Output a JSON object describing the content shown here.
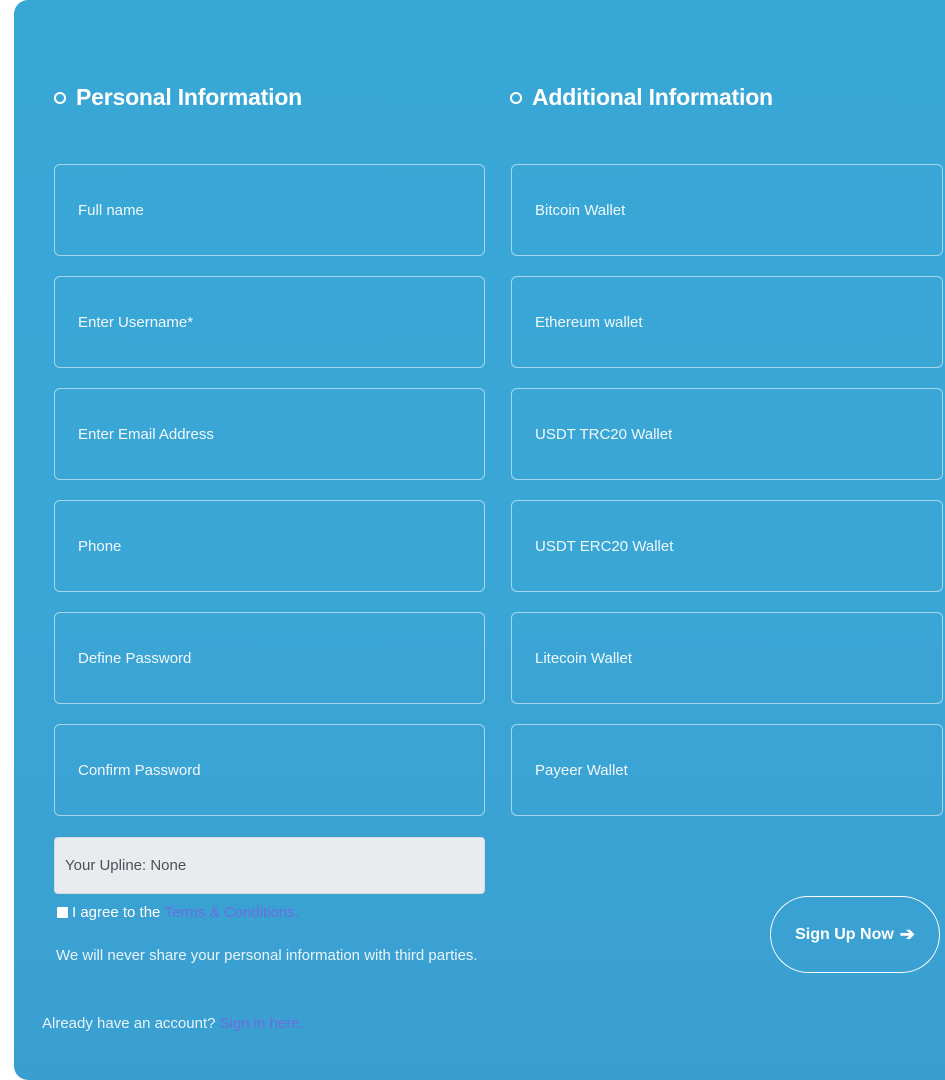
{
  "personal": {
    "title": "Personal Information",
    "fields": [
      {
        "placeholder": "Full name"
      },
      {
        "placeholder": "Enter Username*"
      },
      {
        "placeholder": "Enter Email Address"
      },
      {
        "placeholder": "Phone"
      },
      {
        "placeholder": "Define Password"
      },
      {
        "placeholder": "Confirm Password"
      }
    ],
    "upline_placeholder": "Your Upline: None"
  },
  "additional": {
    "title": "Additional Information",
    "fields": [
      {
        "placeholder": "Bitcoin Wallet"
      },
      {
        "placeholder": "Ethereum wallet"
      },
      {
        "placeholder": "USDT TRC20 Wallet"
      },
      {
        "placeholder": "USDT ERC20 Wallet"
      },
      {
        "placeholder": "Litecoin Wallet"
      },
      {
        "placeholder": "Payeer Wallet"
      }
    ]
  },
  "agree": {
    "prefix": "I agree to the ",
    "link": "Terms & Conditions."
  },
  "privacy_note": "We will never share your personal information with third parties.",
  "already": {
    "prefix": "Already have an account? ",
    "link": "Sign in here."
  },
  "signup_button": {
    "label": "Sign Up Now",
    "icon": "arrow-right-icon",
    "arrow_glyph": "➔"
  },
  "colors": {
    "panel_bg": "#38a6d6",
    "link": "#6b6ee0",
    "upline_bg": "#e9ecef"
  }
}
